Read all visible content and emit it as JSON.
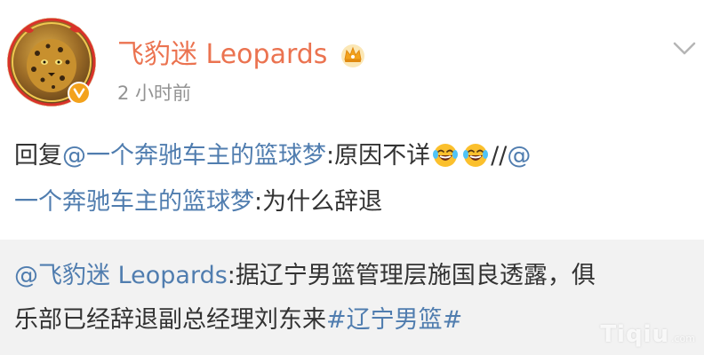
{
  "post": {
    "author": {
      "name": "飞豹迷 Leopards",
      "avatar_icon": "leopard-avatar",
      "badge_icon": "vip-badge-icon",
      "crown_icon": "crown-icon"
    },
    "timestamp": "2 小时前",
    "menu_icon": "chevron-down-icon",
    "content": {
      "reply_prefix": "回复",
      "mention_1": "@一个奔驰车主的篮球梦",
      "reply_text": ":原因不详",
      "emojis": [
        "laugh-cry-emoji",
        "laugh-cry-emoji"
      ],
      "forward_sep": "//",
      "mention_2_part1": "@",
      "mention_2_part2": "一个奔驰车主的篮球梦",
      "forward_text": ":为什么辞退"
    }
  },
  "retweet": {
    "mention": "@飞豹迷 Leopards",
    "text_line1": ":据辽宁男篮管理层施国良透露，俱",
    "text_line2": "乐部已经辞退副总经理刘东来",
    "hashtag": "#辽宁男篮#"
  },
  "watermark": {
    "main": "Tiqiu",
    "sub": ".com"
  },
  "colors": {
    "username": "#eb7350",
    "link": "#507daf",
    "text": "#333333",
    "timestamp": "#939393",
    "retweet_bg": "#f2f2f2"
  }
}
